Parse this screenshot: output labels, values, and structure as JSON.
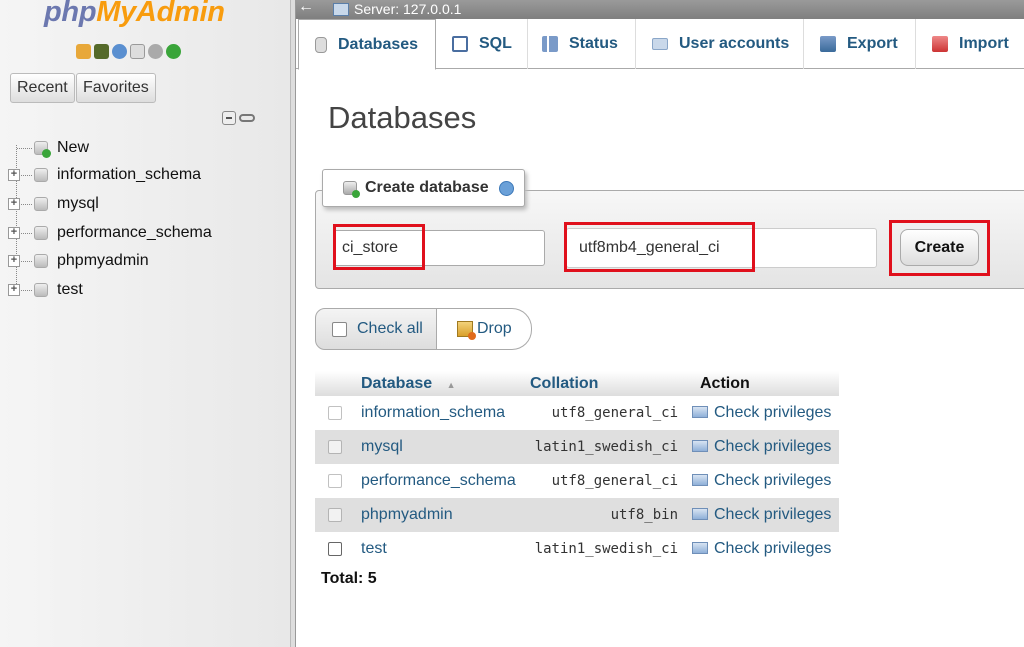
{
  "nav": {
    "logo_php": "php",
    "logo_myadmin": "MyAdmin",
    "recent_label": "Recent",
    "favorites_label": "Favorites",
    "tree": [
      {
        "label": "New",
        "type": "new"
      },
      {
        "label": "information_schema",
        "type": "db"
      },
      {
        "label": "mysql",
        "type": "db"
      },
      {
        "label": "performance_schema",
        "type": "db"
      },
      {
        "label": "phpmyadmin",
        "type": "db"
      },
      {
        "label": "test",
        "type": "db"
      }
    ]
  },
  "topbar": {
    "back_glyph": "←",
    "server_label": "Server: 127.0.0.1"
  },
  "menu": {
    "tabs": [
      {
        "label": "Databases",
        "icon": "database-icon",
        "active": true
      },
      {
        "label": "SQL",
        "icon": "sql-icon",
        "active": false
      },
      {
        "label": "Status",
        "icon": "status-icon",
        "active": false
      },
      {
        "label": "User accounts",
        "icon": "users-icon",
        "active": false
      },
      {
        "label": "Export",
        "icon": "export-icon",
        "active": false
      },
      {
        "label": "Import",
        "icon": "import-icon",
        "active": false
      }
    ]
  },
  "main": {
    "page_title": "Databases",
    "create": {
      "legend": "Create database",
      "db_name_value": "ci_store",
      "collation_value": "utf8mb4_general_ci",
      "create_label": "Create"
    },
    "actions": {
      "check_all_label": "Check all",
      "drop_label": "Drop"
    },
    "table": {
      "headers": {
        "database": "Database",
        "sort_glyph": "▲",
        "collation": "Collation",
        "action": "Action"
      },
      "rows": [
        {
          "name": "information_schema",
          "collation": "utf8_general_ci",
          "action": "Check privileges"
        },
        {
          "name": "mysql",
          "collation": "latin1_swedish_ci",
          "action": "Check privileges"
        },
        {
          "name": "performance_schema",
          "collation": "utf8_general_ci",
          "action": "Check privileges"
        },
        {
          "name": "phpmyadmin",
          "collation": "utf8_bin",
          "action": "Check privileges"
        },
        {
          "name": "test",
          "collation": "latin1_swedish_ci",
          "action": "Check privileges"
        }
      ]
    },
    "total_label": "Total: 5"
  },
  "colors": {
    "link": "#235a81",
    "highlight": "#e0101c",
    "logo_php": "#6c78af",
    "logo_myadmin": "#f89c0e"
  }
}
